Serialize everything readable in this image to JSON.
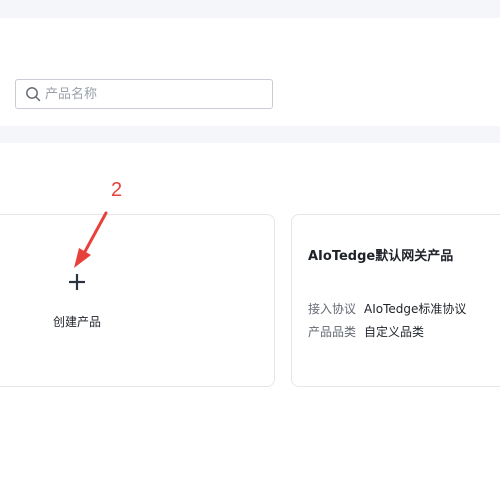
{
  "search": {
    "placeholder": "产品名称",
    "value": ""
  },
  "annotation": {
    "step": "2",
    "color": "#e8413b"
  },
  "create_card": {
    "label": "创建产品",
    "icon": "plus-icon"
  },
  "products": [
    {
      "title": "AIoTedge默认网关产品",
      "protocol_label": "接入协议",
      "protocol_value": "AIoTedge标准协议",
      "category_label": "产品品类",
      "category_value": "自定义品类"
    }
  ]
}
